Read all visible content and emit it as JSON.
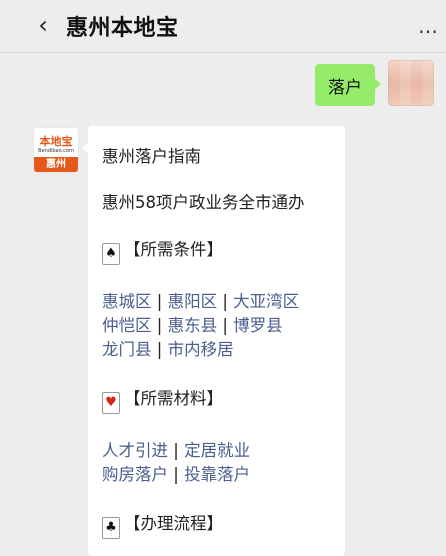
{
  "header": {
    "title": "惠州本地宝",
    "back_icon": "‹",
    "more_icon": "…"
  },
  "chat": {
    "outgoing_message": "落户",
    "incoming": {
      "avatar_logo_main": "本地宝",
      "avatar_logo_sub": "Bendibao.com",
      "avatar_logo_city": "惠州",
      "title": "惠州落户指南",
      "subtitle": "惠州58项户政业务全市通办",
      "section1_title": "【所需条件】",
      "section1_links_row1": [
        "惠城区",
        "惠阳区",
        "大亚湾区"
      ],
      "section1_links_row2": [
        "仲恺区",
        "惠东县",
        "博罗县"
      ],
      "section1_links_row3": [
        "龙门县",
        "市内移居"
      ],
      "section2_title": "【所需材料】",
      "section2_links_row1": [
        "人才引进",
        "定居就业"
      ],
      "section2_links_row2": [
        "购房落户",
        "投靠落户"
      ],
      "section3_title": "【办理流程】",
      "separator": "|"
    }
  }
}
